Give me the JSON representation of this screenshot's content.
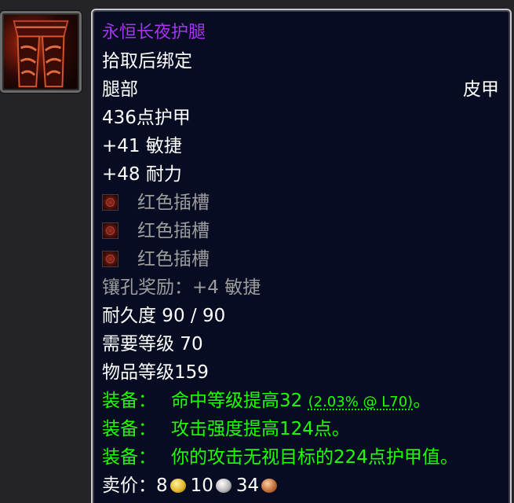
{
  "item": {
    "name": "永恒长夜护腿",
    "binding": "拾取后绑定",
    "slot": "腿部",
    "armor_type": "皮甲",
    "armor": "436点护甲",
    "stats": [
      "+41 敏捷",
      "+48 耐力"
    ],
    "sockets": [
      {
        "icon": "red-socket-icon",
        "label": "红色插槽"
      },
      {
        "icon": "red-socket-icon",
        "label": "红色插槽"
      },
      {
        "icon": "red-socket-icon",
        "label": "红色插槽"
      }
    ],
    "socket_bonus": "镶孔奖励：+4 敏捷",
    "durability": "耐久度 90 / 90",
    "required_level": "需要等级 70",
    "item_level": "物品等级159",
    "equip_effects": [
      {
        "label": "装备：",
        "text": "命中等级提高32",
        "note": "(2.03% @ L70)",
        "suffix": "。"
      },
      {
        "label": "装备：",
        "text": "攻击强度提高124点。",
        "note": "",
        "suffix": ""
      },
      {
        "label": "装备：",
        "text": "你的攻击无视目标的224点护甲值。",
        "note": "",
        "suffix": ""
      }
    ],
    "sell_price": {
      "label": "卖价：",
      "gold": "8",
      "silver": "10",
      "copper": "34"
    }
  },
  "colors": {
    "epic": "#a335ee",
    "white": "#ffffff",
    "gray": "#9d9d9d",
    "green": "#1eff00",
    "tooltip_bg": "#070c22",
    "tooltip_border": "#c9c9c9"
  },
  "icon": "leather-leggings-icon"
}
